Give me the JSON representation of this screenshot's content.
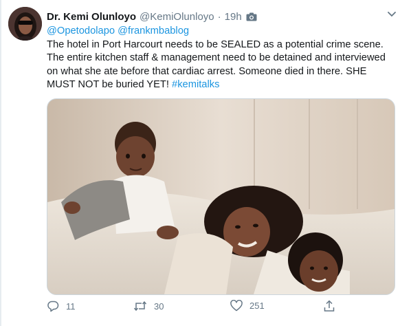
{
  "tweet": {
    "author_name": "Dr. Kemi Olunloyo",
    "author_handle": "@KemiOlunloyo",
    "separator": "·",
    "timestamp": "19h",
    "mentions": [
      "@Opetodolapo",
      "@frankmbablog"
    ],
    "text_lines": [
      "The hotel in Port Harcourt needs to be SEALED as a potential crime scene.",
      "The entire kitchen staff & management need to be detained and interviewed",
      "on what she ate before that cardiac arrest. Someone died in there. SHE"
    ],
    "last_line_text": "MUST NOT be buried YET!",
    "hashtag": "#kemitalks",
    "actions": {
      "reply_count": "11",
      "retweet_count": "30",
      "like_count": "251"
    }
  },
  "icons": {
    "attached_media": "camera-icon",
    "menu": "chevron-down-icon",
    "reply": "reply-icon",
    "retweet": "retweet-icon",
    "like": "heart-icon",
    "share": "share-icon"
  },
  "colors": {
    "link": "#1b95e0",
    "secondary_text": "#657786",
    "primary_text": "#14171a",
    "border": "#ccd6dd"
  }
}
